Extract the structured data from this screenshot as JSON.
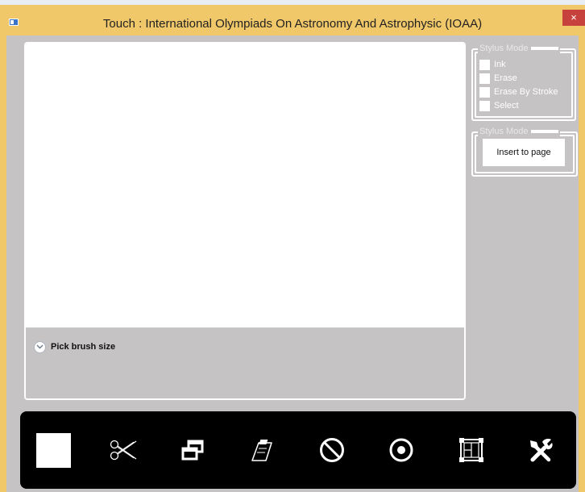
{
  "window": {
    "title": "Touch : International Olympiads On Astronomy And Astrophysic (IOAA)",
    "close_glyph": "×",
    "icon": "app-window-icon",
    "title_bar_color": "#f0c869",
    "client_color": "#c5c3c4"
  },
  "canvas": {
    "brush_size_label": "Pick brush size",
    "expander_icon": "chevron-down-circle-icon"
  },
  "stylus_group": {
    "title": "Stylus Mode",
    "options": [
      "Ink",
      "Erase",
      "Erase By Stroke",
      "Select"
    ]
  },
  "insert_group": {
    "title": "Stylus Mode",
    "button_label": "Insert to page"
  },
  "toolbar": {
    "background": "#000000",
    "tools": [
      "color-swatch-square",
      "scissors-icon",
      "copy-windows-icon",
      "clipboard-paste-icon",
      "no-entry-icon",
      "record-circle-icon",
      "frame-select-icon",
      "tools-icon"
    ]
  }
}
